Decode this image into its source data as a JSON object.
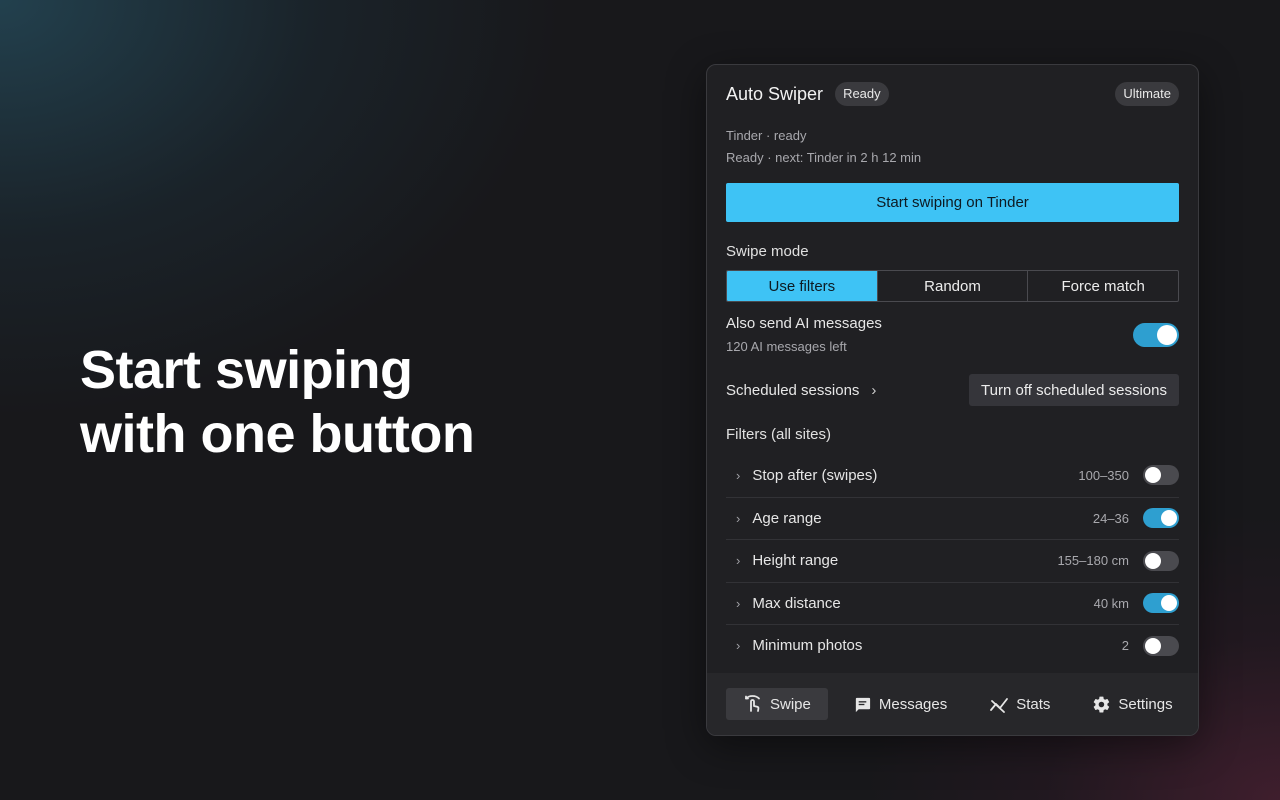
{
  "headline": {
    "line1": "Start swiping",
    "line2": "with one button"
  },
  "panel": {
    "title": "Auto Swiper",
    "status_badge": "Ready",
    "plan_badge": "Ultimate",
    "status_line1": "Tinder · ready",
    "status_line2": "Ready · next: Tinder in 2 h 12 min",
    "start_button": "Start swiping on Tinder",
    "swipe_mode": {
      "label": "Swipe mode",
      "options": [
        "Use filters",
        "Random",
        "Force match"
      ],
      "selected": "Use filters"
    },
    "ai_messages": {
      "title": "Also send AI messages",
      "subtitle": "120 AI messages left",
      "enabled": true
    },
    "scheduled": {
      "label": "Scheduled sessions",
      "button": "Turn off scheduled sessions"
    },
    "filters": {
      "label": "Filters (all sites)",
      "items": [
        {
          "name": "Stop after (swipes)",
          "value": "100–350",
          "enabled": false
        },
        {
          "name": "Age range",
          "value": "24–36",
          "enabled": true
        },
        {
          "name": "Height range",
          "value": "155–180 cm",
          "enabled": false
        },
        {
          "name": "Max distance",
          "value": "40 km",
          "enabled": true
        },
        {
          "name": "Minimum photos",
          "value": "2",
          "enabled": false
        }
      ]
    },
    "nav": {
      "items": [
        {
          "label": "Swipe",
          "icon": "swipe-icon",
          "active": true
        },
        {
          "label": "Messages",
          "icon": "message-icon",
          "active": false
        },
        {
          "label": "Stats",
          "icon": "stats-icon",
          "active": false
        },
        {
          "label": "Settings",
          "icon": "gear-icon",
          "active": false
        }
      ]
    }
  },
  "colors": {
    "accent": "#3ec3f5",
    "toggle_on": "#2e9fd0",
    "panel_bg": "#202023",
    "page_bg": "#18181b"
  }
}
